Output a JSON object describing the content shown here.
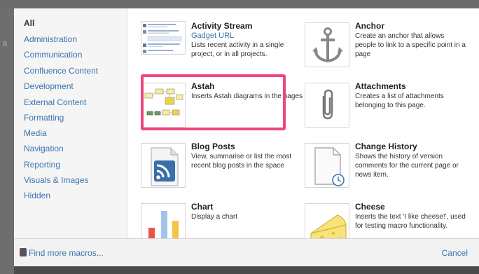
{
  "categories": [
    "All",
    "Administration",
    "Communication",
    "Confluence Content",
    "Development",
    "External Content",
    "Formatting",
    "Media",
    "Navigation",
    "Reporting",
    "Visuals & Images",
    "Hidden"
  ],
  "selected_category": "All",
  "macros": {
    "activity_stream": {
      "title": "Activity Stream",
      "link": "Gadget URL",
      "description": "Lists recent activity in a single project, or in all projects.",
      "icon": "activity-stream-thumbnail"
    },
    "anchor": {
      "title": "Anchor",
      "description": "Create an anchor that allows people to link to a specific point in a page",
      "icon": "anchor-icon"
    },
    "astah": {
      "title": "Astah",
      "description": "Inserts Astah diagrams in the pages",
      "icon": "astah-diagram-thumbnail"
    },
    "attachments": {
      "title": "Attachments",
      "description": "Creates a list of attachments belonging to this page.",
      "icon": "paperclip-icon"
    },
    "blog_posts": {
      "title": "Blog Posts",
      "description": "View, summarise or list the most recent blog posts in the space",
      "icon": "rss-document-icon"
    },
    "change_history": {
      "title": "Change History",
      "description": "Shows the history of version comments for the current page or news item.",
      "icon": "document-clock-icon"
    },
    "chart": {
      "title": "Chart",
      "description": "Display a chart",
      "icon": "bar-chart-icon"
    },
    "cheese": {
      "title": "Cheese",
      "description": "Inserts the text 'I like cheese!', used for testing macro functionality.",
      "icon": "cheese-icon"
    }
  },
  "footer": {
    "find_more_label": "Find more macros...",
    "cancel_label": "Cancel"
  },
  "colors": {
    "link": "#3b73af",
    "highlight": "#f0457a",
    "sidebar_bg": "#f5f5f5",
    "footer_bg": "#f2f2f2",
    "backdrop": "#4a4a4a"
  }
}
